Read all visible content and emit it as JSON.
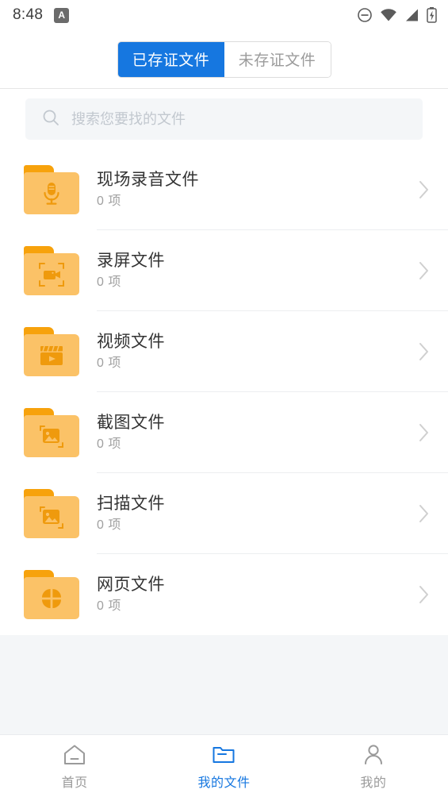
{
  "statusbar": {
    "time": "8:48",
    "app_badge": "A",
    "icons": [
      "do-not-disturb-icon",
      "wifi-icon",
      "cellular-signal-icon",
      "battery-charging-icon"
    ]
  },
  "header": {
    "tabs": [
      {
        "label": "已存证文件",
        "active": true
      },
      {
        "label": "未存证文件",
        "active": false
      }
    ]
  },
  "search": {
    "placeholder": "搜索您要找的文件",
    "value": "",
    "icon": "search-icon"
  },
  "files": {
    "item_suffix": "项",
    "rows": [
      {
        "title": "现场录音文件",
        "count": "0 项",
        "icon": "microphone-folder-icon"
      },
      {
        "title": "录屏文件",
        "count": "0 项",
        "icon": "screen-record-folder-icon"
      },
      {
        "title": "视频文件",
        "count": "0 项",
        "icon": "video-folder-icon"
      },
      {
        "title": "截图文件",
        "count": "0 项",
        "icon": "screenshot-folder-icon"
      },
      {
        "title": "扫描文件",
        "count": "0 项",
        "icon": "scan-folder-icon"
      },
      {
        "title": "网页文件",
        "count": "0 项",
        "icon": "webpage-folder-icon"
      }
    ]
  },
  "tabbar": {
    "items": [
      {
        "label": "首页",
        "icon": "home-icon",
        "active": false
      },
      {
        "label": "我的文件",
        "icon": "folder-icon",
        "active": true
      },
      {
        "label": "我的",
        "icon": "person-icon",
        "active": false
      }
    ]
  },
  "colors": {
    "accent": "#1677e0",
    "folder_tab": "#f7a20c",
    "folder_body": "#fbc267",
    "folder_glyph": "#ef9a0d",
    "text_primary": "#333333",
    "text_secondary": "#a0a0a0",
    "page_bg": "#f4f6f8"
  }
}
